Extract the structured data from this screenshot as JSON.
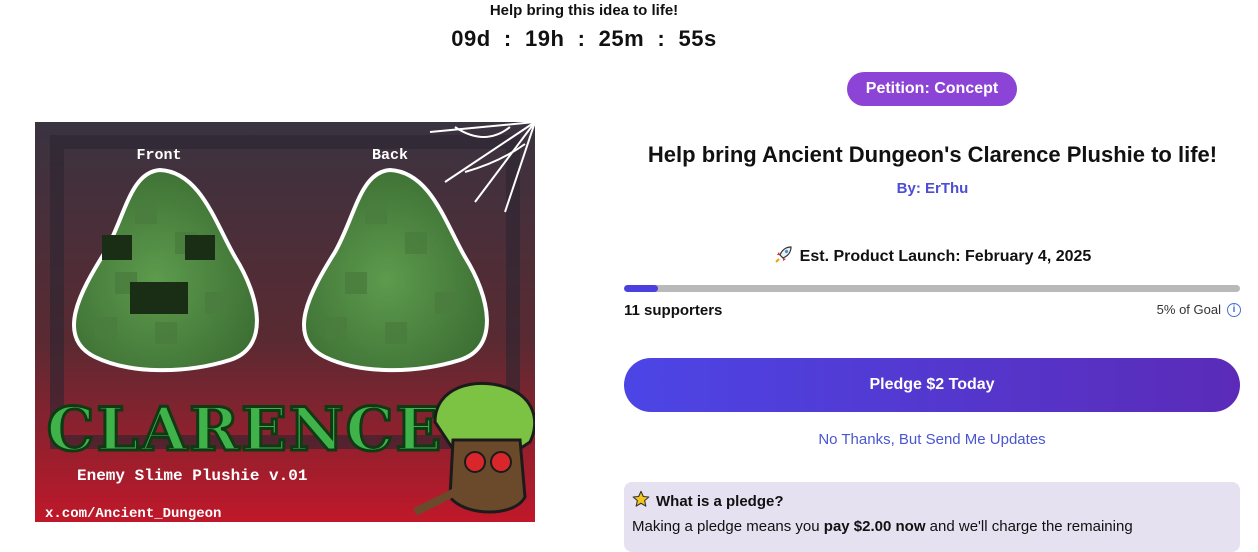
{
  "countdown": {
    "label": "Help bring this idea to life!",
    "text": "09d  :  19h  :  25m  :  55s"
  },
  "badge": {
    "label": "Petition: Concept",
    "color": "#8b44d6"
  },
  "hero": {
    "front_label": "Front",
    "back_label": "Back",
    "logo_text": "CLARENCE",
    "subtitle": "Enemy Slime Plushie v.01",
    "handle": "x.com/Ancient_Dungeon"
  },
  "project": {
    "title": "Help bring Ancient Dungeon's Clarence Plushie to life!",
    "by_prefix": "By:",
    "author": "ErThu",
    "launch_icon": "rocket-icon",
    "launch_text": "Est. Product Launch: February 4, 2025"
  },
  "progress": {
    "fraction": 0.05,
    "supporters": "11 supporters",
    "goal_text": "5% of Goal"
  },
  "actions": {
    "pledge_label": "Pledge $2 Today",
    "no_thanks_label": "No Thanks, But Send Me Updates"
  },
  "pledge_info": {
    "icon": "star-icon",
    "title": "What is a pledge?",
    "text_start": "Making a pledge means you ",
    "text_bold": "pay $2.00 now",
    "text_end": " and we'll charge the remaining"
  },
  "colors": {
    "accent": "#4c45e6",
    "link": "#4a56d0",
    "info_bg": "#e6e1f0"
  }
}
